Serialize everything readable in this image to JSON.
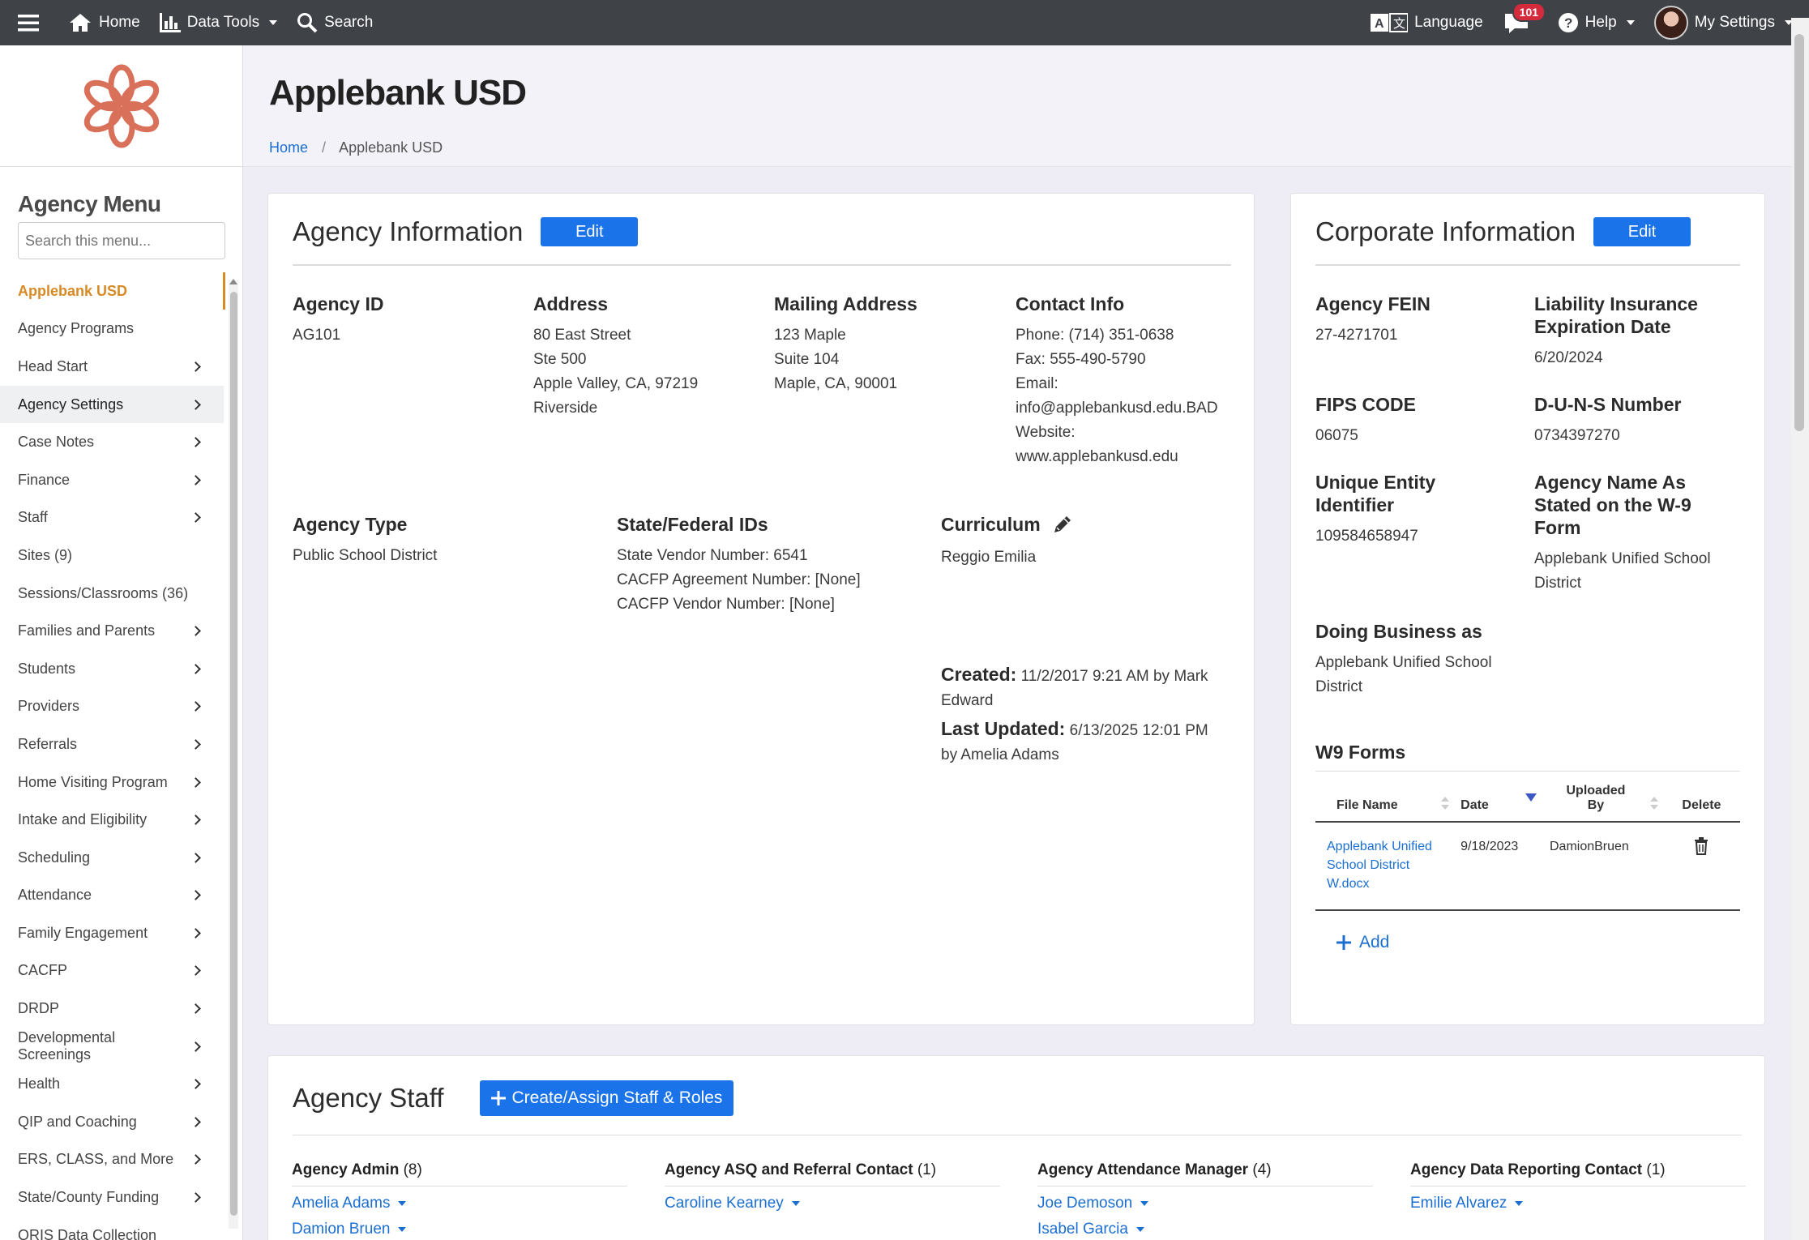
{
  "topbar": {
    "home": "Home",
    "data_tools": "Data Tools",
    "search": "Search",
    "language": "Language",
    "notifications_count": "101",
    "help": "Help",
    "my_settings": "My Settings"
  },
  "sidebar": {
    "title": "Agency Menu",
    "search_placeholder": "Search this menu...",
    "items": [
      {
        "label": "Applebank USD",
        "chevron": false
      },
      {
        "label": "Agency Programs",
        "chevron": false
      },
      {
        "label": "Head Start",
        "chevron": true
      },
      {
        "label": "Agency Settings",
        "chevron": true
      },
      {
        "label": "Case Notes",
        "chevron": true
      },
      {
        "label": "Finance",
        "chevron": true
      },
      {
        "label": "Staff",
        "chevron": true
      },
      {
        "label": "Sites (9)",
        "chevron": false
      },
      {
        "label": "Sessions/Classrooms (36)",
        "chevron": false
      },
      {
        "label": "Families and Parents",
        "chevron": true
      },
      {
        "label": "Students",
        "chevron": true
      },
      {
        "label": "Providers",
        "chevron": true
      },
      {
        "label": "Referrals",
        "chevron": true
      },
      {
        "label": "Home Visiting Program",
        "chevron": true
      },
      {
        "label": "Intake and Eligibility",
        "chevron": true
      },
      {
        "label": "Scheduling",
        "chevron": true
      },
      {
        "label": "Attendance",
        "chevron": true
      },
      {
        "label": "Family Engagement",
        "chevron": true
      },
      {
        "label": "CACFP",
        "chevron": true
      },
      {
        "label": "DRDP",
        "chevron": true
      },
      {
        "label": "Developmental Screenings",
        "chevron": true
      },
      {
        "label": "Health",
        "chevron": true
      },
      {
        "label": "QIP and Coaching",
        "chevron": true
      },
      {
        "label": "ERS, CLASS, and More",
        "chevron": true
      },
      {
        "label": "State/County Funding",
        "chevron": true
      },
      {
        "label": "QRIS Data Collection",
        "chevron": false
      }
    ]
  },
  "page": {
    "title": "Applebank USD",
    "breadcrumb": [
      "Home",
      "Applebank USD"
    ]
  },
  "agency_info": {
    "title": "Agency Information",
    "edit_label": "Edit",
    "agency_id_label": "Agency ID",
    "agency_id": "AG101",
    "address_label": "Address",
    "address_line1": "80 East Street",
    "address_line2": "Ste 500",
    "address_line3": "Apple Valley, CA, 97219",
    "address_line4": "Riverside",
    "mailing_label": "Mailing Address",
    "mailing_line1": "123 Maple",
    "mailing_line2": "Suite 104",
    "mailing_line3": "Maple, CA, 90001",
    "contact_label": "Contact Info",
    "phone": "Phone: (714) 351-0638",
    "fax": "Fax: 555-490-5790",
    "email_label": "Email:",
    "email": "info@applebankusd.edu.BAD",
    "website_label": "Website:",
    "website": "www.applebankusd.edu",
    "type_label": "Agency Type",
    "type": "Public School District",
    "ids_label": "State/Federal IDs",
    "state_vendor": "State Vendor Number: 6541",
    "cacfp_agreement": "CACFP Agreement Number: [None]",
    "cacfp_vendor": "CACFP Vendor Number: [None]",
    "curriculum_label": "Curriculum",
    "curriculum": "Reggio Emilia",
    "created_label": "Created:",
    "created_value": "11/2/2017 9:21 AM by Mark",
    "created_value2": "Edward",
    "updated_label": "Last Updated:",
    "updated_value": "6/13/2025 12:01 PM",
    "updated_value2": "by Amelia Adams"
  },
  "corporate_info": {
    "title": "Corporate Information",
    "edit_label": "Edit",
    "fein_label": "Agency FEIN",
    "fein": "27-4271701",
    "liability_label_1": "Liability Insurance",
    "liability_label_2": "Expiration Date",
    "liability": "6/20/2024",
    "fips_label": "FIPS CODE",
    "fips": "06075",
    "duns_label": "D-U-N-S Number",
    "duns": "0734397270",
    "uei_label_1": "Unique Entity",
    "uei_label_2": "Identifier",
    "uei": "109584658947",
    "w9name_label_1": "Agency Name As",
    "w9name_label_2": "Stated on the W-9",
    "w9name_label_3": "Form",
    "w9name_1": "Applebank Unified School",
    "w9name_2": "District",
    "dba_label": "Doing Business as",
    "dba_1": "Applebank Unified School",
    "dba_2": "District",
    "w9_title": "W9 Forms",
    "w9_columns": [
      "File Name",
      "Date",
      "Uploaded",
      "By",
      "Delete"
    ],
    "w9_rows": [
      {
        "file_1": "Applebank Unified",
        "file_2": "School District",
        "file_3": "W.docx",
        "date": "9/18/2023",
        "by": "DamionBruen"
      }
    ],
    "add_label": "Add"
  },
  "staff": {
    "title": "Agency Staff",
    "create_label": "Create/Assign Staff & Roles",
    "roles": [
      {
        "name": "Agency Admin",
        "count": "(8)",
        "people": [
          "Amelia Adams",
          "Damion Bruen"
        ]
      },
      {
        "name": "Agency ASQ and Referral Contact",
        "count": "(1)",
        "people": [
          "Caroline Kearney"
        ]
      },
      {
        "name": "Agency Attendance Manager",
        "count": "(4)",
        "people": [
          "Joe Demoson",
          "Isabel Garcia"
        ]
      },
      {
        "name": "Agency Data Reporting Contact",
        "count": "(1)",
        "people": [
          "Emilie Alvarez"
        ]
      }
    ]
  },
  "colors": {
    "accent": "#1a73e8",
    "active_menu": "#d88a24",
    "topbar": "#3f4348",
    "logo": "#d9705a",
    "badge": "#d32b3c"
  }
}
